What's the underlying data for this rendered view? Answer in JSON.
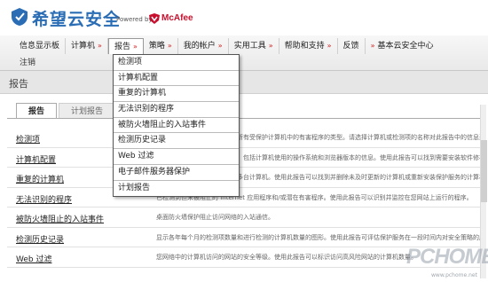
{
  "brand": {
    "logo_text": "希望云安全",
    "powered_by": "Powered by",
    "partner": "McAfee"
  },
  "nav": {
    "items": [
      {
        "label": "信息显示板",
        "arrow": ""
      },
      {
        "label": "计算机",
        "arrow": "»"
      },
      {
        "label": "报告",
        "arrow": "»"
      },
      {
        "label": "策略",
        "arrow": "»"
      },
      {
        "label": "我的帐户",
        "arrow": "»"
      },
      {
        "label": "实用工具",
        "arrow": "»"
      },
      {
        "label": "帮助和支持",
        "arrow": "»"
      },
      {
        "label": "反馈",
        "arrow": ""
      },
      {
        "label": "基本云安全中心",
        "arrow": "»"
      }
    ],
    "logout": "注销"
  },
  "page_title": "报告",
  "tabs": [
    {
      "label": "报告"
    },
    {
      "label": "计划报告"
    }
  ],
  "rows": [
    {
      "label": "检测项",
      "desc": "下列报告可帮助您监视网络中所有受保护计算机中的有害程序的类型。请选择计算机或检测项的名称对此报告中的信息进行分类。单击"
    },
    {
      "label": "计算机配置",
      "desc": "此报告显示计算机的配置信息，包括计算机使用的操作系统和浏览器版本的信息。使用此报告可以找到需要安装软件修补程序"
    },
    {
      "label": "重复的计算机",
      "desc": "此报告显示了具有相同名称的多台计算机。使用此报告可以找到并删除未及时更新的计算机或重新安装保护服务的计算机。了解"
    },
    {
      "label": "无法识别的程序",
      "desc": "已检测到但未被阻止的 Internet 应用程序和/或潜在有害程序。使用此报告可以识别并监控在您网站上运行的程序。"
    },
    {
      "label": "被防火墙阻止的入站事件",
      "desc": "桌面防火墙保护阻止访问网络的入站通信。"
    },
    {
      "label": "检测历史记录",
      "desc": "显示各年每个月的检测项数量和进行检测的计算机数量的图形。使用此报告可评估保护服务在一段时间内对安全策略的成效。"
    },
    {
      "label": "Web 过滤",
      "desc": "您网络中的计算机访问的网站的安全等级。使用此报告可以标识访问高风险网站的计算机数量。"
    }
  ],
  "dropdown": {
    "items": [
      "检测项",
      "计算机配置",
      "重复的计算机",
      "无法识别的程序",
      "被防火墙阻止的入站事件",
      "检测历史记录",
      "Web 过滤",
      "电子邮件服务器保护",
      "计划报告"
    ]
  },
  "watermark": {
    "text": "PCHOME",
    "url": "www.pchome.net"
  },
  "colors": {
    "brand_blue": "#2a6db5",
    "mcafee_red": "#c8102e",
    "nav_arrow": "#d02020"
  }
}
